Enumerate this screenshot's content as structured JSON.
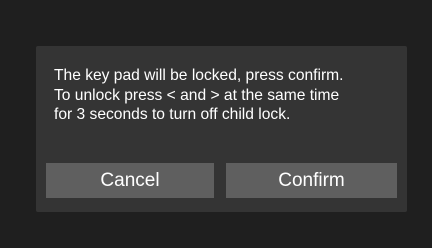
{
  "dialog": {
    "message_lines": [
      "The key pad will be locked, press confirm.",
      "To unlock press < and > at the same time",
      "for 3 seconds to turn off child lock."
    ],
    "cancel_label": "Cancel",
    "confirm_label": "Confirm"
  },
  "colors": {
    "background": "#1f1f1f",
    "dialog_background": "#343434",
    "button_background": "#5f5f5f",
    "text": "#ffffff"
  }
}
